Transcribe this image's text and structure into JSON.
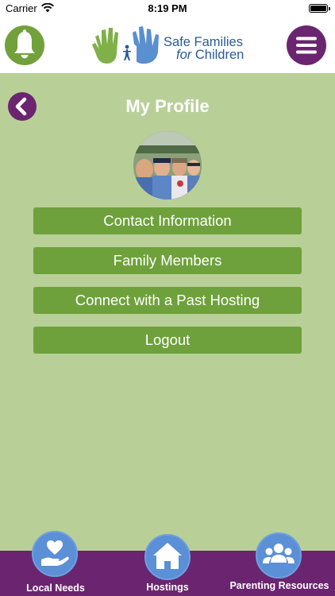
{
  "status_bar": {
    "carrier": "Carrier",
    "time": "8:19 PM"
  },
  "header": {
    "logo_line1": "Safe Families",
    "logo_line2_italic": "for",
    "logo_line2": "Children"
  },
  "page": {
    "title": "My Profile"
  },
  "menu": [
    {
      "label": "Contact Information"
    },
    {
      "label": "Family Members"
    },
    {
      "label": "Connect with a Past Hosting"
    },
    {
      "label": "Logout"
    }
  ],
  "tabbar": {
    "tabs": [
      {
        "label": "Local Needs",
        "icon": "hand-heart-icon"
      },
      {
        "label": "Hostings",
        "icon": "house-icon"
      },
      {
        "label": "Parenting Resources",
        "icon": "people-group-icon"
      }
    ]
  },
  "colors": {
    "background": "#b9cf98",
    "green": "#6ea13b",
    "purple": "#6b2570",
    "tab_blue": "#5b8fd6"
  }
}
